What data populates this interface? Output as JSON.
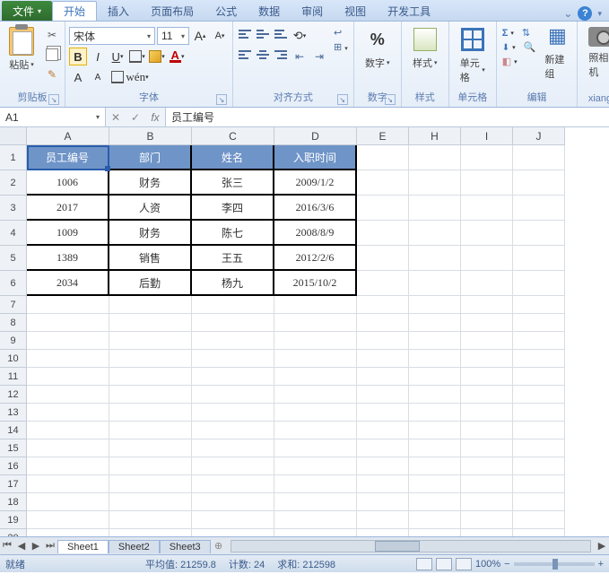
{
  "tabs": {
    "file": "文件",
    "home": "开始",
    "insert": "插入",
    "layout": "页面布局",
    "formula": "公式",
    "data": "数据",
    "review": "审阅",
    "view": "视图",
    "dev": "开发工具"
  },
  "ribbon": {
    "clipboard": {
      "paste": "粘贴",
      "label": "剪贴板"
    },
    "font": {
      "name": "宋体",
      "size": "11",
      "label": "字体"
    },
    "align": {
      "label": "对齐方式"
    },
    "number": {
      "label": "数字",
      "btn": "数字"
    },
    "style": {
      "label": "样式",
      "btn": "样式"
    },
    "cells": {
      "label": "单元格",
      "btn": "单元格"
    },
    "edit": {
      "label": "编辑",
      "newgrp": "新建组"
    },
    "camera": {
      "btn": "照相机",
      "label": "xiangji"
    }
  },
  "grid": {
    "activeCell": "A1",
    "formula": "员工编号",
    "cols": [
      "A",
      "B",
      "C",
      "D",
      "E",
      "H",
      "I",
      "J"
    ],
    "headers": [
      "员工编号",
      "部门",
      "姓名",
      "入职时间"
    ],
    "rows": [
      {
        "id": "1006",
        "dept": "财务",
        "name": "张三",
        "date": "2009/1/2"
      },
      {
        "id": "2017",
        "dept": "人资",
        "name": "李四",
        "date": "2016/3/6"
      },
      {
        "id": "1009",
        "dept": "财务",
        "name": "陈七",
        "date": "2008/8/9"
      },
      {
        "id": "1389",
        "dept": "销售",
        "name": "王五",
        "date": "2012/2/6"
      },
      {
        "id": "2034",
        "dept": "后勤",
        "name": "杨九",
        "date": "2015/10/2"
      }
    ]
  },
  "sheets": [
    "Sheet1",
    "Sheet2",
    "Sheet3"
  ],
  "status": {
    "ready": "就绪",
    "avg": "平均值: 21259.8",
    "count": "计数: 24",
    "sum": "求和: 212598",
    "zoom": "100%"
  }
}
